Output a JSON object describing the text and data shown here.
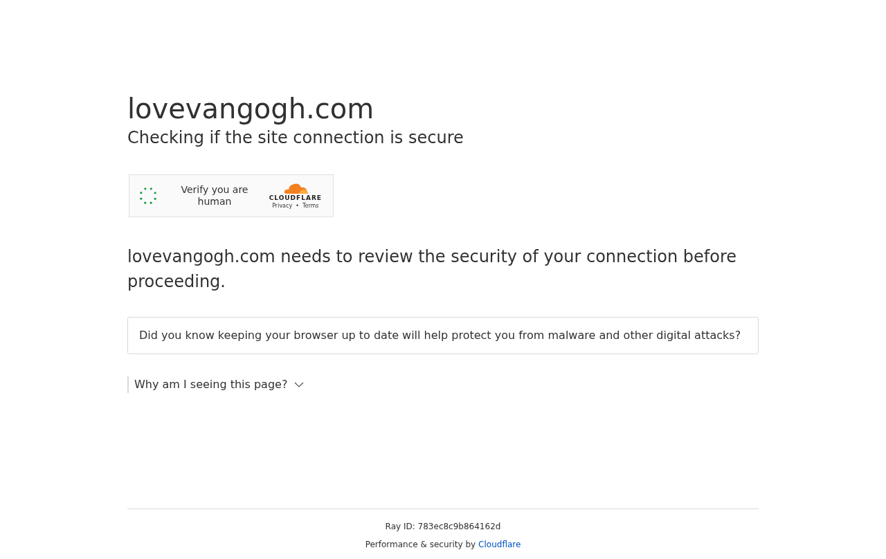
{
  "heading": "lovevangogh.com",
  "subheading": "Checking if the site connection is secure",
  "widget": {
    "label": "Verify you are human",
    "brand": "CLOUDFLARE",
    "links": [
      "Privacy",
      "•",
      "Terms"
    ]
  },
  "message": "lovevangogh.com needs to review the security of your connection before proceeding.",
  "tip": "Did you know keeping your browser up to date will help protect you from malware and other digital attacks?",
  "details": {
    "label": "Why am I seeing this page?",
    "expanded": false
  },
  "footer": {
    "ray_id": "Ray ID: 783ec8c9b864162d",
    "credit": "Performance & security by",
    "link": "Cloudflare"
  }
}
